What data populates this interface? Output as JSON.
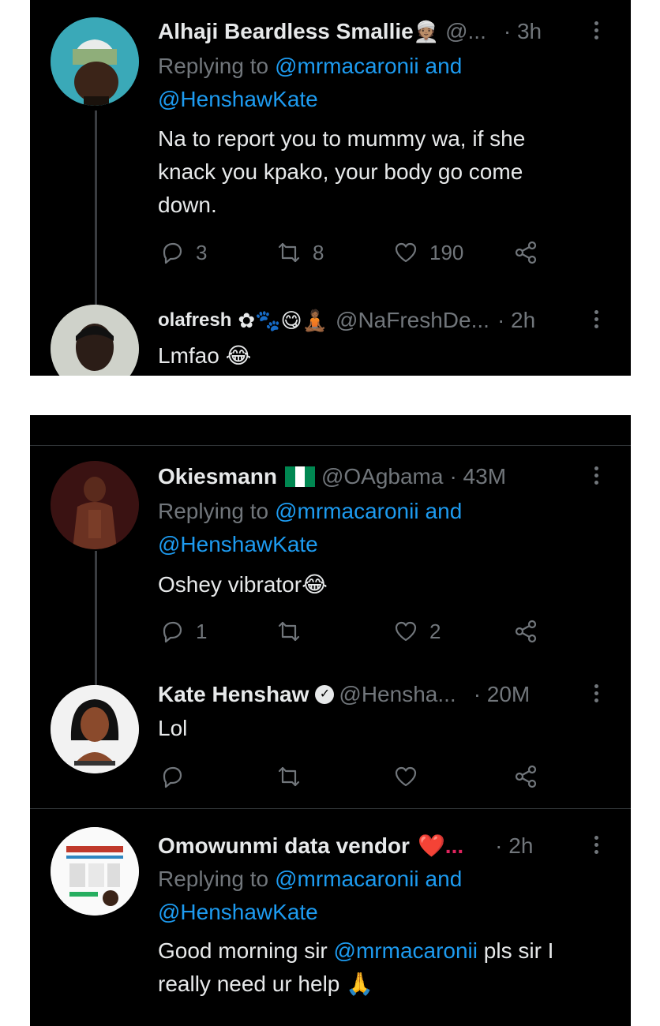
{
  "replying_prefix": "Replying to",
  "and_word": "and",
  "tweets": [
    {
      "display_name": "Alhaji Beardless Smallie",
      "name_emoji": "👳🏽",
      "handle": "@...",
      "time": "· 3h",
      "reply_to_1": "@mrmacaronii",
      "reply_to_2": "@HenshawKate",
      "text_lines": [
        "Na to report you to mummy wa, if she",
        "knack you kpako, your body go come",
        "down."
      ],
      "replies": "3",
      "retweets": "8",
      "likes": "190"
    },
    {
      "display_name": "olafresh",
      "name_emoji": "✿🐾😋🧘🏾",
      "handle": "@NaFreshDe...",
      "time": "· 2h",
      "text": "Lmfao 😂"
    },
    {
      "display_name": "Okiesmann",
      "handle": "@OAgbama",
      "time": "· 43M",
      "reply_to_1": "@mrmacaronii",
      "reply_to_2": "@HenshawKate",
      "text": "Oshey vibrator😂",
      "replies": "1",
      "retweets": "",
      "likes": "2"
    },
    {
      "display_name": "Kate Henshaw",
      "handle": "@Hensha...",
      "time": "· 20M",
      "text": "Lol"
    },
    {
      "display_name": "Omowunmi data vendor",
      "name_emoji": "❤️...",
      "time": "· 2h",
      "reply_to_1": "@mrmacaronii",
      "reply_to_2": "@HenshawKate",
      "text_line1_prefix": "Good morning sir",
      "text_line1_mention": "@mrmacaronii",
      "text_line1_suffix": "pls sir I",
      "text_line2": "really need ur help 🙏"
    }
  ],
  "colors": {
    "background": "#000000",
    "text": "#e7e9ea",
    "muted": "#71767b",
    "link": "#1d9bf0",
    "flag_green": "#008751",
    "heart_red": "#e0245e"
  },
  "icons": [
    "reply-icon",
    "retweet-icon",
    "like-icon",
    "share-icon",
    "more-icon",
    "verified-icon",
    "nigeria-flag-icon"
  ]
}
